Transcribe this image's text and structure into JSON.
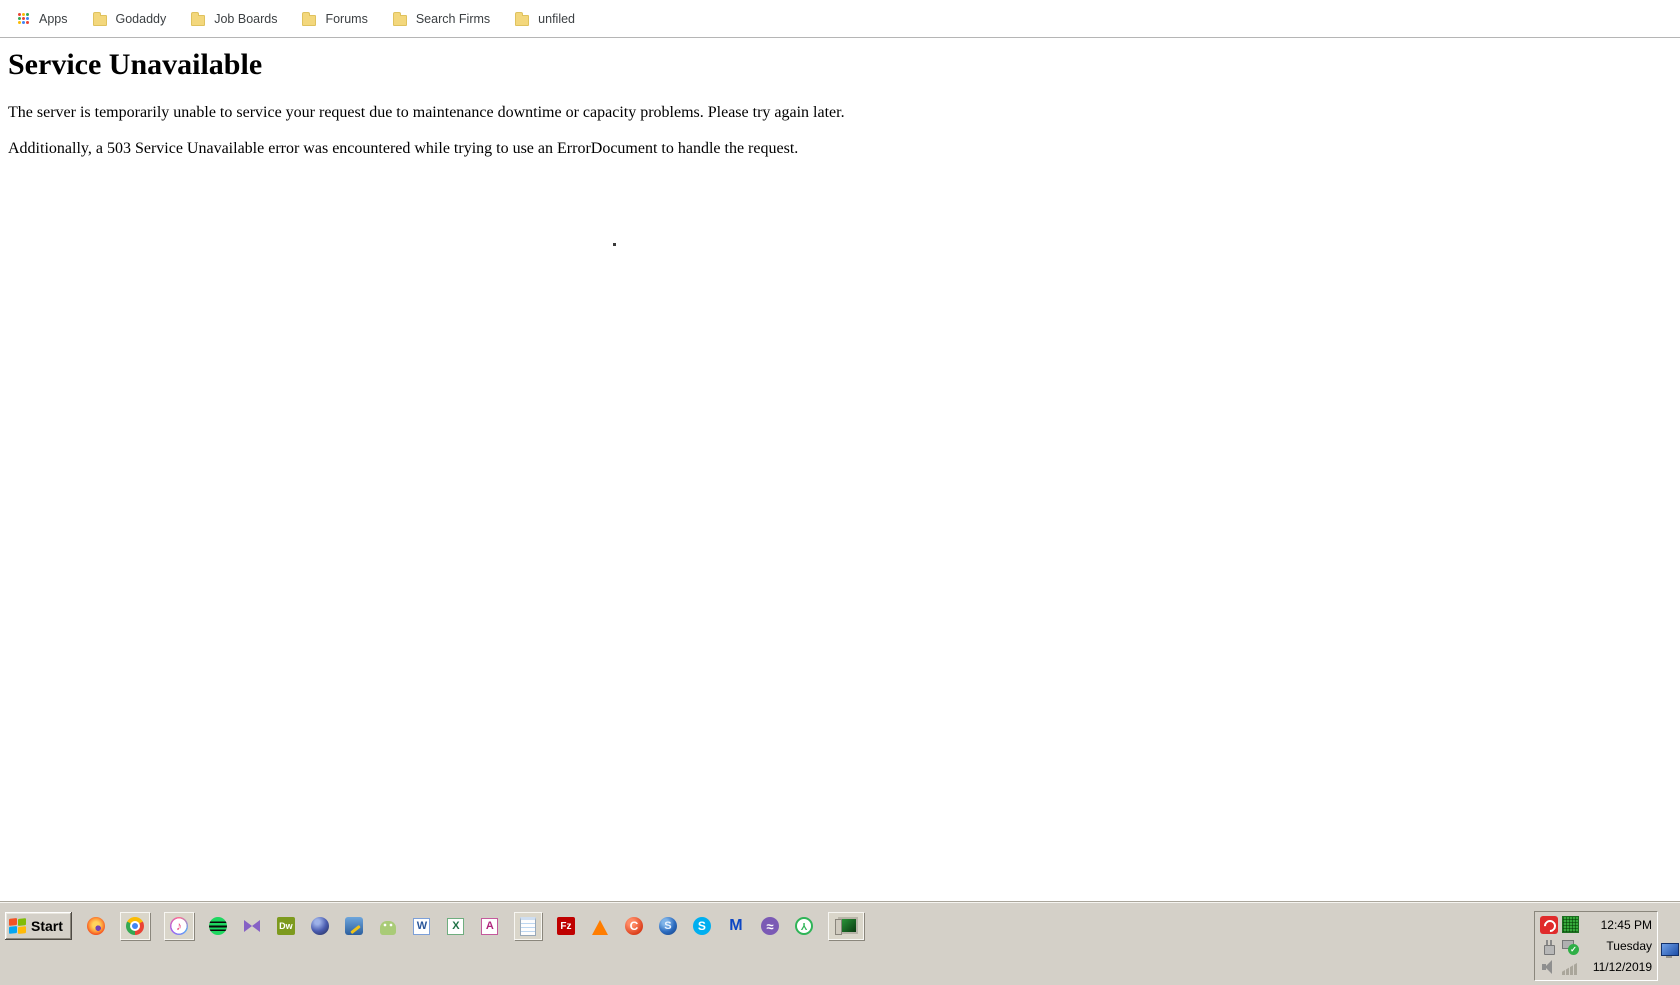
{
  "bookmarks_bar": {
    "items": [
      {
        "label": "Apps",
        "icon": "apps-grid"
      },
      {
        "label": "Godaddy",
        "icon": "folder"
      },
      {
        "label": "Job Boards",
        "icon": "folder"
      },
      {
        "label": "Forums",
        "icon": "folder"
      },
      {
        "label": "Search Firms",
        "icon": "folder"
      },
      {
        "label": "unfiled",
        "icon": "folder"
      }
    ]
  },
  "page": {
    "heading": "Service Unavailable",
    "paragraphs": [
      "The server is temporarily unable to service your request due to maintenance downtime or capacity problems. Please try again later.",
      "Additionally, a 503 Service Unavailable error was encountered while trying to use an ErrorDocument to handle the request."
    ]
  },
  "taskbar": {
    "start_label": "Start",
    "quick_launch": [
      {
        "name": "firefox"
      },
      {
        "name": "chrome",
        "active": true
      },
      {
        "name": "itunes",
        "active": true
      },
      {
        "name": "spotify"
      },
      {
        "name": "visual-studio"
      },
      {
        "name": "dreamweaver",
        "label": "Dw"
      },
      {
        "name": "eclipse"
      },
      {
        "name": "code-editor"
      },
      {
        "name": "android"
      },
      {
        "name": "word",
        "label": "W"
      },
      {
        "name": "excel",
        "label": "X"
      },
      {
        "name": "access",
        "label": "A"
      },
      {
        "name": "notepad",
        "active": true
      },
      {
        "name": "filezilla",
        "label": "Fz"
      },
      {
        "name": "vlc"
      },
      {
        "name": "ccleaner",
        "label": "C"
      },
      {
        "name": "steam",
        "label": "S"
      },
      {
        "name": "skype",
        "label": "S"
      },
      {
        "name": "malwarebytes",
        "label": "M"
      },
      {
        "name": "bittorrent",
        "label": "≈"
      },
      {
        "name": "green-ring-utility",
        "label": "Y"
      },
      {
        "name": "my-computer",
        "active": true
      }
    ],
    "tray": {
      "time": "12:45 PM",
      "day": "Tuesday",
      "date": "11/12/2019",
      "icons": [
        "avira-antivirus",
        "network-activity-monitor",
        "power-plug",
        "usb-safely-remove",
        "volume",
        "signal-strength",
        "remote-display"
      ]
    }
  },
  "misc": {
    "itunes_glyph": "♪"
  },
  "colors": {
    "taskbar_bg": "#d4d0c8",
    "bookmark_folder": "#f3d77c",
    "spotify_green": "#1ed760",
    "skype_blue": "#00aff0",
    "avira_red": "#e02b2b",
    "chrome_blue": "#4285f4",
    "filezilla_red": "#bf0000",
    "vlc_orange": "#ff7d00"
  }
}
